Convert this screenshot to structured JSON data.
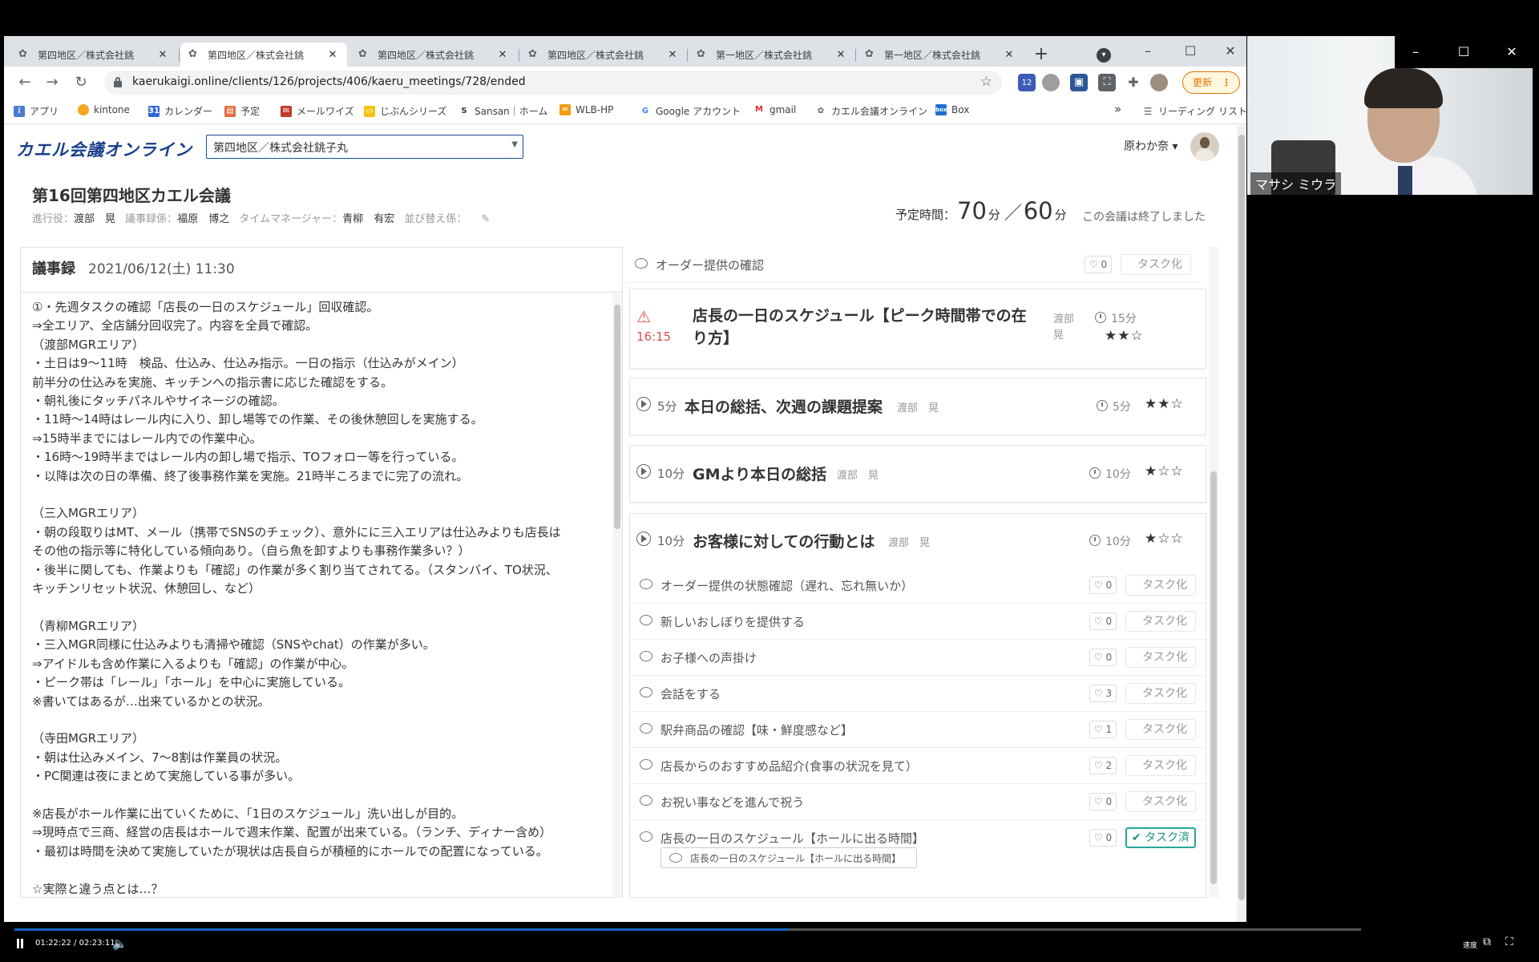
{
  "browser": {
    "tabs": [
      {
        "title": "第四地区／株式会社銚"
      },
      {
        "title": "第四地区／株式会社銚"
      },
      {
        "title": "第四地区／株式会社銚"
      },
      {
        "title": "第四地区／株式会社銚"
      },
      {
        "title": "第一地区／株式会社銚"
      },
      {
        "title": "第一地区／株式会社銚"
      }
    ],
    "new_tab": "+",
    "url": "kaerukaigi.online/clients/126/projects/406/kaeru_meetings/728/ended",
    "update_label": "更新",
    "ext_badge": "12",
    "bookmarks": [
      {
        "label": "アプリ",
        "color": "#4a7bd0"
      },
      {
        "label": "kintone",
        "color": "#f5a623"
      },
      {
        "label": "カレンダー",
        "color": "#3367d6"
      },
      {
        "label": "予定",
        "color": "#e06c3c"
      },
      {
        "label": "メールワイズ",
        "color": "#c0392b"
      },
      {
        "label": "じぶんシリーズ",
        "color": "#f4c20d"
      },
      {
        "label": "Sansan｜ホーム",
        "color": "#333333"
      },
      {
        "label": "WLB-HP",
        "color": "#f39c12"
      },
      {
        "label": "Google アカウント",
        "color": "#4285f4"
      },
      {
        "label": "gmail",
        "color": "#d93025"
      },
      {
        "label": "カエル会議オンライン",
        "color": "#5f6368"
      },
      {
        "label": "Box",
        "color": "#1f6fd1"
      }
    ],
    "bookmarks_overflow": "»",
    "reading_list": "リーディング リスト"
  },
  "app": {
    "logo": "カエル会議オンライン",
    "project": "第四地区／株式会社銚子丸",
    "user": "原わか奈 ▾"
  },
  "meeting": {
    "title": "第16回第四地区カエル会議",
    "roles": {
      "facilitator_label": "進行役：",
      "facilitator": "渡部　晃",
      "secretary_label": "議事録係：",
      "secretary": "福原　博之",
      "timekeeper_label": "タイムマネージャー：",
      "timekeeper": "青柳　有宏",
      "sort_label": "並び替え係："
    },
    "time_label": "予定時間：",
    "actual": "70",
    "planned": "60",
    "unit": "分",
    "slash": "／",
    "status": "この会議は終了しました"
  },
  "minutes": {
    "title": "議事録",
    "datetime": "2021/06/12(土) 11:30",
    "lines": [
      "①・先週タスクの確認「店長の一日のスケジュール」回収確認。",
      "⇒全エリア、全店舗分回収完了。内容を全員で確認。",
      "（渡部MGRエリア）",
      "・土日は9～11時　検品、仕込み、仕込み指示。一日の指示（仕込みがメイン）",
      "前半分の仕込みを実施、キッチンへの指示書に応じた確認をする。",
      "・朝礼後にタッチパネルやサイネージの確認。",
      "・11時～14時はレール内に入り、卸し場等での作業、その後休憩回しを実施する。",
      "⇒15時半までにはレール内での作業中心。",
      "・16時～19時半まではレール内の卸し場で指示、TOフォロー等を行っている。",
      "・以降は次の日の準備、終了後事務作業を実施。21時半ころまでに完了の流れ。",
      "",
      "（三入MGRエリア）",
      "・朝の段取りはMT、メール（携帯でSNSのチェック）、意外にに三入エリアは仕込みよりも店長は",
      "その他の指示等に特化している傾向あり。（自ら魚を卸すよりも事務作業多い？）",
      "・後半に関しても、作業よりも「確認」の作業が多く割り当てされてる。（スタンバイ、TO状況、",
      "キッチンリセット状況、休憩回し、など）",
      "",
      "（青柳MGRエリア）",
      "・三入MGR同様に仕込みよりも清掃や確認（SNSやchat）の作業が多い。",
      "⇒アイドルも含め作業に入るよりも「確認」の作業が中心。",
      "・ピーク帯は「レール」「ホール」を中心に実施している。",
      "※書いてはあるが…出来ているかとの状況。",
      "",
      "（寺田MGRエリア）",
      "・朝は仕込みメイン、7～8割は作業員の状況。",
      "・PC関連は夜にまとめて実施している事が多い。",
      "",
      "※店長がホール作業に出ていくために、「1日のスケジュール」洗い出しが目的。",
      "⇒現時点で三商、経営の店長はホールで週末作業、配置が出来ている。（ランチ、ディナー含め）",
      "・最初は時間を決めて実施していたが現状は店長自らが積極的にホールでの配置になっている。",
      "",
      "☆実際と違う点とは…？",
      ""
    ]
  },
  "agenda": {
    "top_note": {
      "text": "オーダー提供の確認",
      "likes": "0",
      "task": "タスク化"
    },
    "item_overtime": {
      "time": "16:15",
      "title_l1": "店長の一日のスケジュール【ピーク時間帯での在",
      "title_l2": "り方】",
      "presenter_l1": "渡部",
      "presenter_l2": "晃",
      "duration": "15分",
      "stars": "★★☆"
    },
    "item1": {
      "prefix": "5分",
      "title": "本日の総括、次週の課題提案",
      "presenter": "渡部　晃",
      "duration": "5分",
      "stars": "★★☆"
    },
    "item2": {
      "prefix": "10分",
      "title": "GMより本日の総括",
      "presenter": "渡部　晃",
      "duration": "10分",
      "stars": "★☆☆"
    },
    "item3": {
      "prefix": "10分",
      "title": "お客様に対しての行動とは",
      "presenter": "渡部　晃",
      "duration": "10分",
      "stars": "★☆☆"
    },
    "notes": [
      {
        "text": "オーダー提供の状態確認（遅れ、忘れ無いか）",
        "likes": "0",
        "task": "タスク化"
      },
      {
        "text": "新しいおしぼりを提供する",
        "likes": "0",
        "task": "タスク化"
      },
      {
        "text": "お子様への声掛け",
        "likes": "0",
        "task": "タスク化"
      },
      {
        "text": "会話をする",
        "likes": "3",
        "task": "タスク化"
      },
      {
        "text": "駅弁商品の確認【味・鮮度感など】",
        "likes": "1",
        "task": "タスク化"
      },
      {
        "text": "店長からのおすすめ品紹介(食事の状況を見て）",
        "likes": "2",
        "task": "タスク化"
      },
      {
        "text": "お祝い事などを進んで祝う",
        "likes": "0",
        "task": "タスク化"
      },
      {
        "text": "店長の一日のスケジュール【ホールに出る時間】",
        "likes": "0",
        "task": "✔ タスク済"
      }
    ],
    "linked_note": "店長の一日のスケジュール【ホールに出る時間】"
  },
  "webcam": {
    "name": "マサシ ミウラ"
  },
  "player": {
    "current": "01:22:22",
    "total": "02:23:11",
    "separator": " / ",
    "progress": 0.575,
    "speed_label": "速度"
  }
}
